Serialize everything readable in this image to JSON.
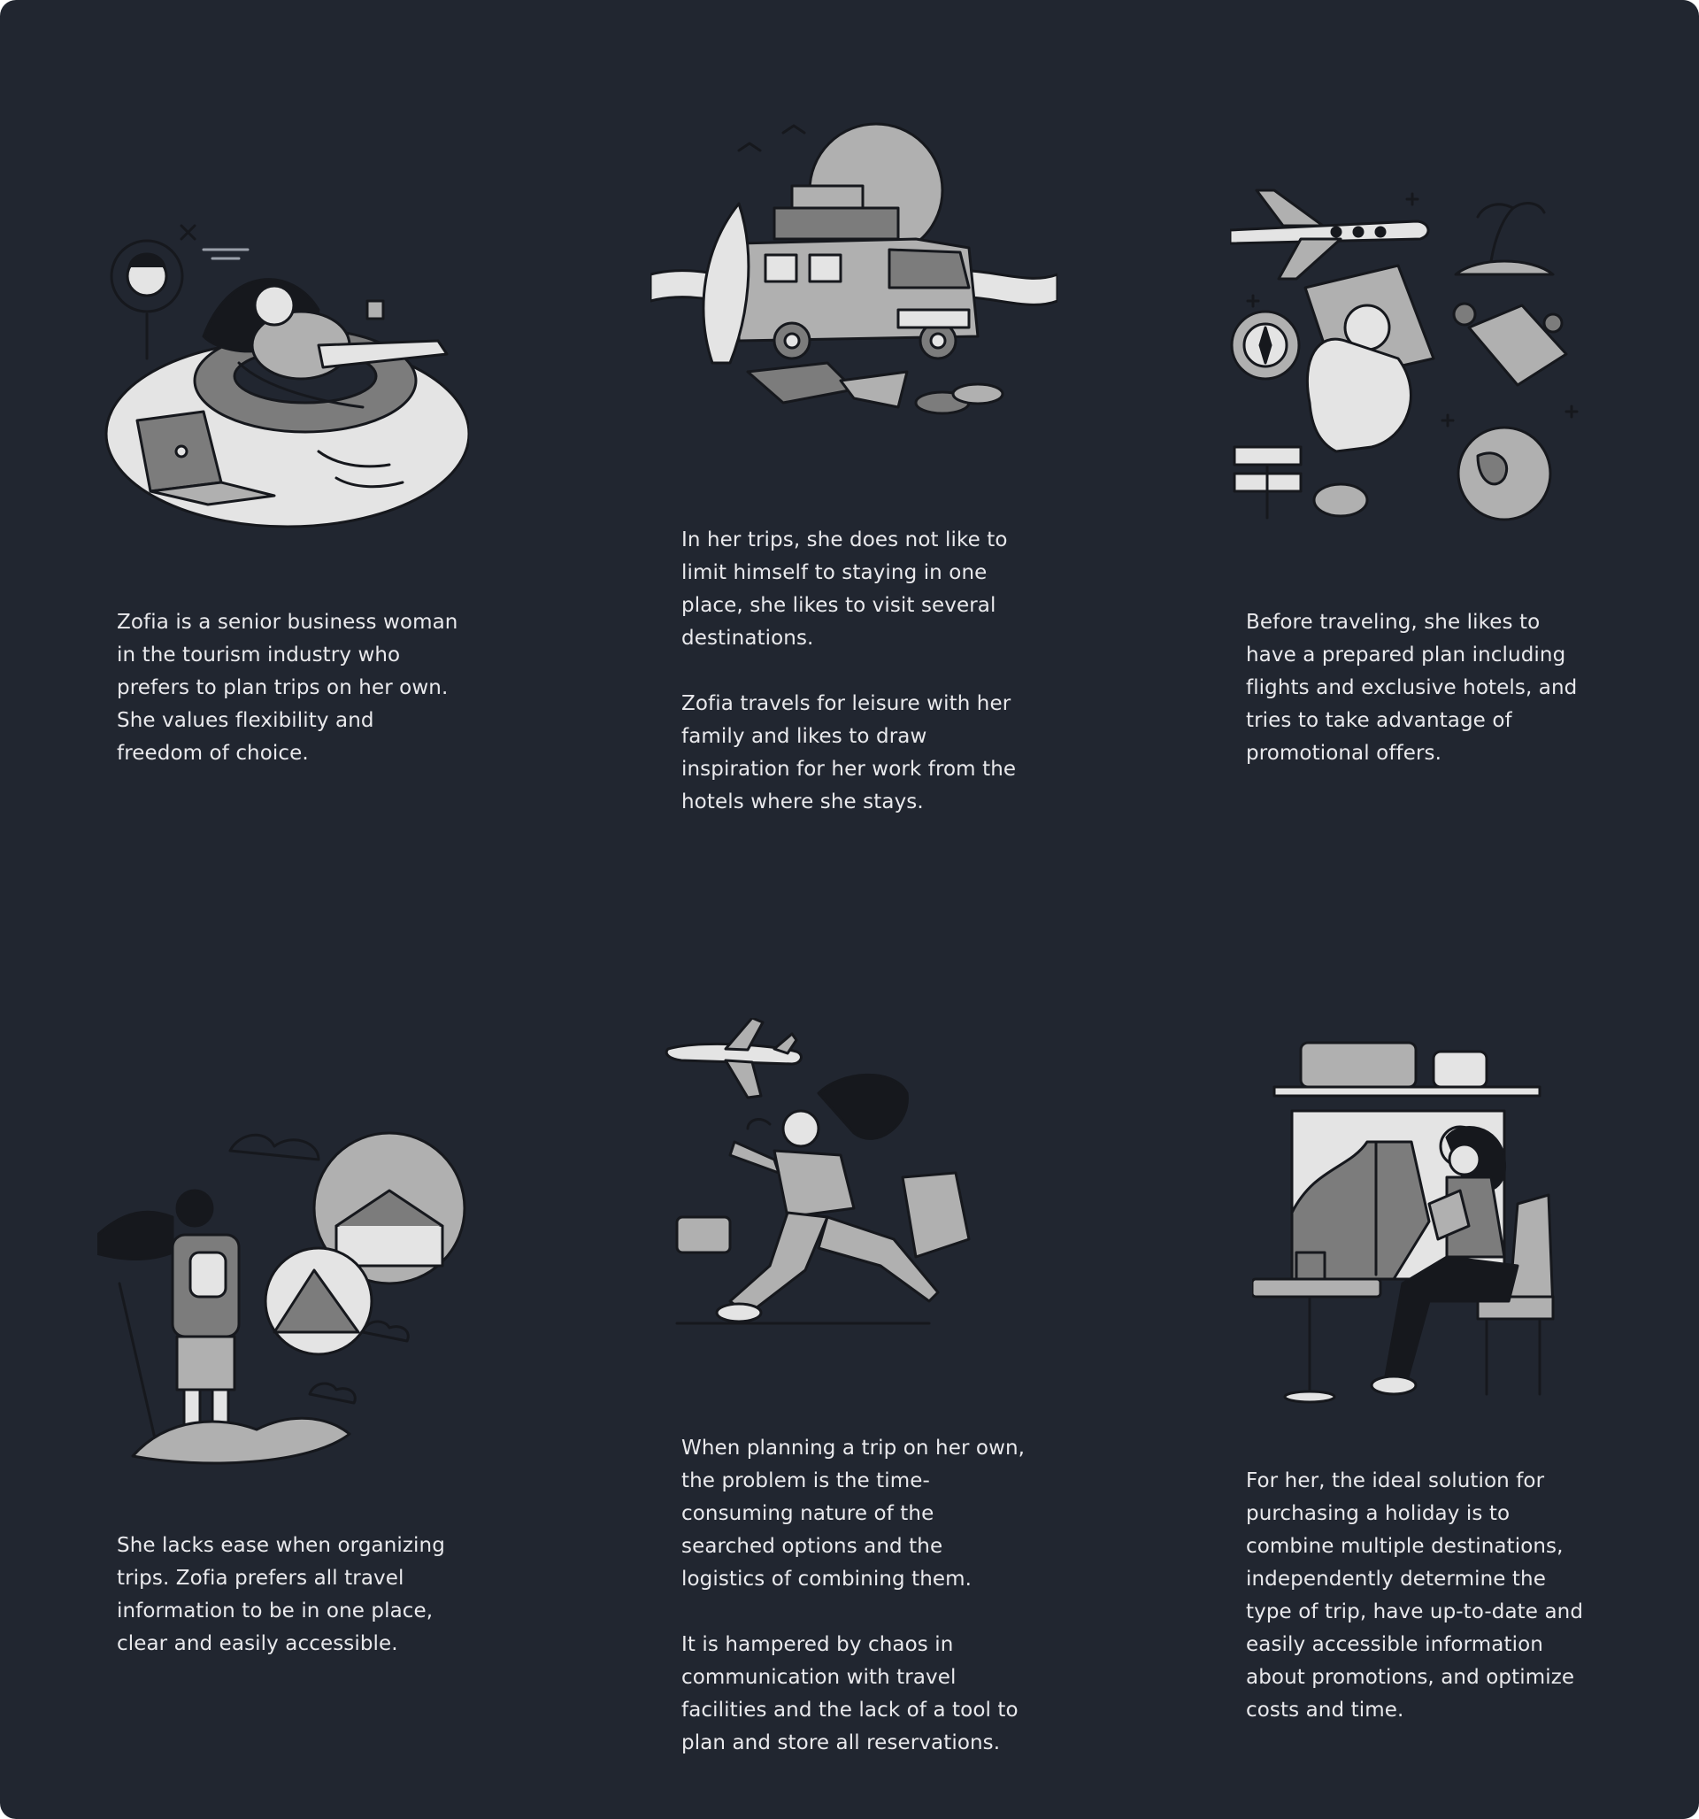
{
  "cards": [
    {
      "illustration": "woman-floating-ring-laptop-icon",
      "paragraphs": [
        "Zofia is a senior business woman in the tourism industry who prefers to plan trips on her own. She values flexibility and freedom of choice."
      ]
    },
    {
      "illustration": "camper-van-luggage-icon",
      "paragraphs": [
        "In her trips, she does not like to limit himself to staying in one place, she likes to visit several destinations.",
        "Zofia travels for leisure with her family and likes to draw inspiration for her work from the hotels where she stays."
      ]
    },
    {
      "illustration": "travel-planning-passport-icon",
      "paragraphs": [
        "Before traveling, she likes to have a prepared plan including flights and exclusive hotels, and tries to take advantage of promotional offers."
      ]
    },
    {
      "illustration": "hiker-destinations-icon",
      "paragraphs": [
        "She lacks ease when organizing trips. Zofia prefers all travel information to be in one place, clear and easily accessible."
      ]
    },
    {
      "illustration": "woman-rushing-airplane-icon",
      "paragraphs": [
        "When planning a trip on her own, the problem is the time-consuming nature of the searched options and the logistics of combining them.",
        "It is hampered by chaos in communication with travel facilities and the lack of a tool to plan and store all reservations."
      ]
    },
    {
      "illustration": "woman-reading-by-window-icon",
      "paragraphs": [
        "For her, the ideal solution for purchasing a holiday is to combine multiple destinations, independently determine the type of trip, have up-to-date and easily accessible information about promotions, and optimize costs and time."
      ]
    }
  ],
  "colors": {
    "background": "#212630",
    "text": "#e9e9ec",
    "ink": "#16181d",
    "gray_light": "#e4e4e4",
    "gray_mid": "#b0b0b0",
    "gray_dark": "#7c7c7c"
  }
}
